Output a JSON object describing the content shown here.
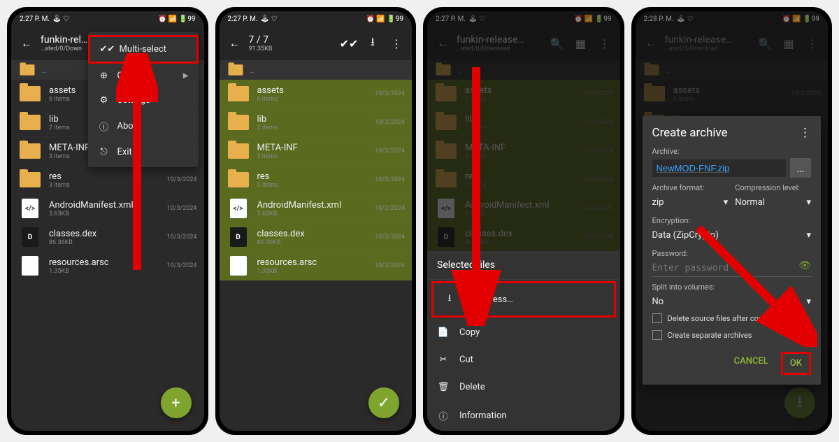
{
  "status": {
    "time1": "2:27 P. M.",
    "time2": "2:27 P. M.",
    "time3": "2:27 P. M.",
    "time4": "2:28 P. M.",
    "right": "⏰ 📶 🔋99"
  },
  "s1": {
    "title": "funkin-rel…",
    "subtitle": "…ated/0/Down",
    "menu": {
      "multiselect": "Multi-select",
      "create": "Create",
      "settings": "Settings",
      "about": "About",
      "exit": "Exit"
    }
  },
  "s2": {
    "title": "7 / 7",
    "subtitle": "91.35KB"
  },
  "s3": {
    "title": "funkin-release…",
    "subtitle": "…ated/0/Download",
    "sheet": {
      "header": "Selected files",
      "compress": "Compress…",
      "copy": "Copy",
      "cut": "Cut",
      "delete": "Delete",
      "info": "Information"
    }
  },
  "s4": {
    "title": "funkin-release…",
    "subtitle": "…ated/0/Download",
    "dialog": {
      "title": "Create archive",
      "archive_label": "Archive:",
      "archive_name": "NewMOD-FNF.zip",
      "format_label": "Archive format:",
      "format_value": "zip",
      "level_label": "Compression level:",
      "level_value": "Normal",
      "encryption_label": "Encryption:",
      "encryption_value": "Data (ZipCrypto)",
      "password_label": "Password:",
      "password_placeholder": "Enter password",
      "split_label": "Split into volumes:",
      "split_value": "No",
      "check_delete": "Delete source files after compression",
      "check_separate": "Create separate archives",
      "cancel": "CANCEL",
      "ok": "OK"
    }
  },
  "files": [
    {
      "name": "assets",
      "type": "folder",
      "meta": "6 items",
      "date": "10/3/2024"
    },
    {
      "name": "lib",
      "type": "folder",
      "meta": "2 items",
      "date": "10/3/2024"
    },
    {
      "name": "META-INF",
      "type": "folder",
      "meta": "3 items",
      "date": "10/3/2024"
    },
    {
      "name": "res",
      "type": "folder",
      "meta": "3 items",
      "date": "10/3/2024"
    },
    {
      "name": "AndroidManifest.xml",
      "type": "xml",
      "meta": "3.63KB",
      "date": "10/3/2024"
    },
    {
      "name": "classes.dex",
      "type": "dex",
      "meta": "86.36KB",
      "date": "10/3/2024"
    },
    {
      "name": "resources.arsc",
      "type": "file",
      "meta": "1.35KB",
      "date": "10/3/2024"
    }
  ],
  "breadcrumb_up": ".."
}
